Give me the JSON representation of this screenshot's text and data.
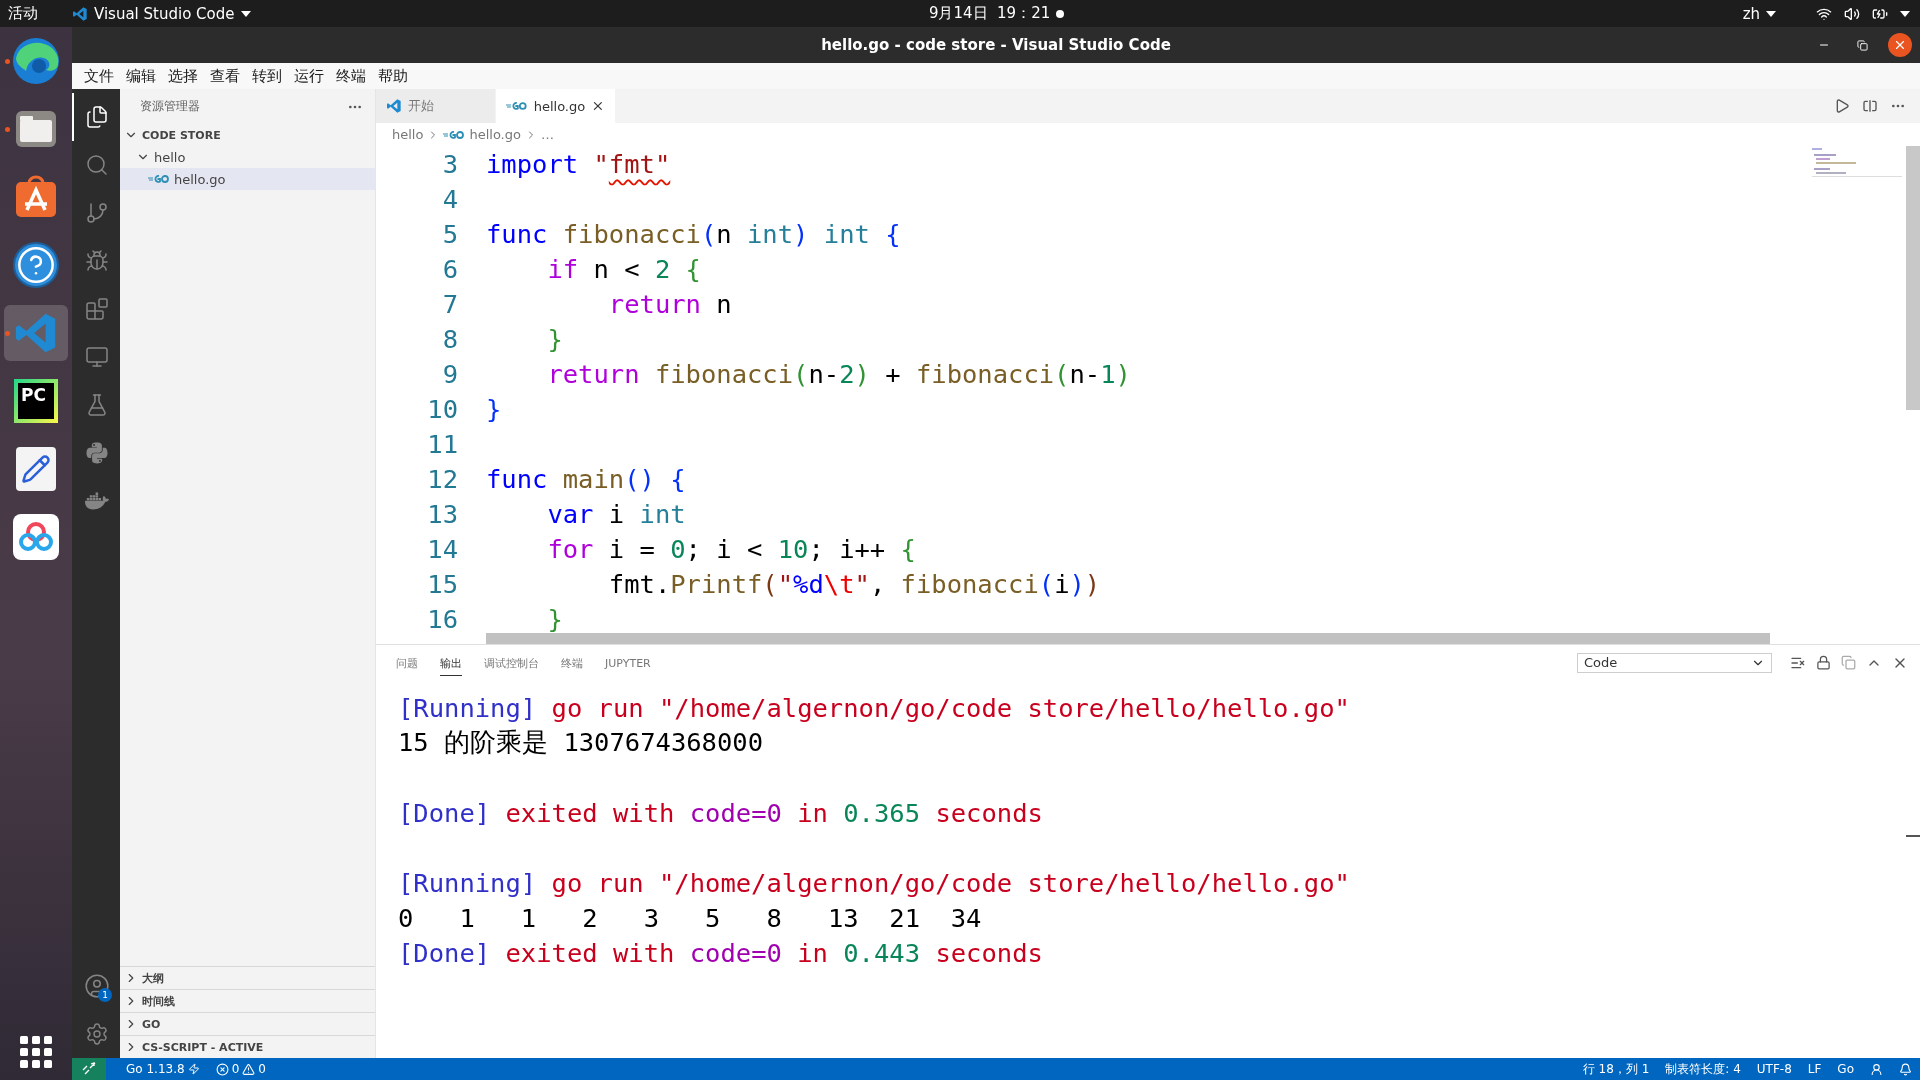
{
  "top_bar": {
    "activities": "活动",
    "app": "Visual Studio Code",
    "clock": "9月14日  19：21",
    "input_method": "zh"
  },
  "dock": [
    {
      "kind": "browser",
      "running": true,
      "selected": false
    },
    {
      "kind": "files",
      "running": true,
      "selected": false
    },
    {
      "kind": "store",
      "running": false,
      "selected": false
    },
    {
      "kind": "help",
      "running": false,
      "selected": false
    },
    {
      "kind": "vscode",
      "running": true,
      "selected": true
    },
    {
      "kind": "pycharm",
      "label": "PC",
      "running": false,
      "selected": false
    },
    {
      "kind": "editor",
      "running": false,
      "selected": false
    },
    {
      "kind": "cloud",
      "running": false,
      "selected": false
    }
  ],
  "window": {
    "title": "hello.go - code store - Visual Studio Code"
  },
  "menu": [
    "文件",
    "编辑",
    "选择",
    "查看",
    "转到",
    "运行",
    "终端",
    "帮助"
  ],
  "activity_bar": {
    "items": [
      {
        "kind": "explorer",
        "selected": true
      },
      {
        "kind": "search",
        "selected": false
      },
      {
        "kind": "source-control",
        "selected": false
      },
      {
        "kind": "run-debug",
        "selected": false
      },
      {
        "kind": "extensions",
        "selected": false
      },
      {
        "kind": "remote",
        "selected": false
      },
      {
        "kind": "testing",
        "selected": false
      },
      {
        "kind": "python",
        "selected": false
      },
      {
        "kind": "docker",
        "selected": false
      }
    ],
    "accounts_badge": "1"
  },
  "sidebar": {
    "title": "资源管理器",
    "workspace": {
      "label": "CODE STORE",
      "expanded": true,
      "children": [
        {
          "label": "hello",
          "expanded": true,
          "children": [
            {
              "label": "hello.go",
              "kind": "go-file",
              "selected": true
            }
          ]
        }
      ]
    },
    "sections": [
      {
        "label": "大纲",
        "expanded": false
      },
      {
        "label": "时间线",
        "expanded": false
      },
      {
        "label": "GO",
        "expanded": false
      },
      {
        "label": "CS-SCRIPT - ACTIVE",
        "expanded": false
      }
    ]
  },
  "editor": {
    "tabs": [
      {
        "label": "开始",
        "kind": "welcome",
        "selected": false
      },
      {
        "label": "hello.go",
        "kind": "go",
        "selected": true
      }
    ],
    "breadcrumbs": [
      {
        "label": "hello",
        "kind": "folder"
      },
      {
        "label": "hello.go",
        "kind": "go"
      },
      {
        "label": "…",
        "kind": "more"
      }
    ],
    "lines": [
      {
        "number": "3",
        "tokens": [
          {
            "kind": "kw",
            "text": "import "
          },
          {
            "kind": "str",
            "text": "\""
          },
          {
            "kind": "str",
            "text": "fmt\"",
            "error": true
          }
        ]
      },
      {
        "number": "4"
      },
      {
        "number": "5",
        "tokens": [
          {
            "kind": "kw",
            "text": "func "
          },
          {
            "kind": "fn",
            "text": "fibonacci"
          },
          {
            "kind": "b1",
            "text": "("
          },
          {
            "kind": "p",
            "text": "n "
          },
          {
            "kind": "type",
            "text": "int"
          },
          {
            "kind": "b1",
            "text": ") "
          },
          {
            "kind": "type",
            "text": "int "
          },
          {
            "kind": "b1",
            "text": "{"
          }
        ]
      },
      {
        "number": "6",
        "tokens": [
          {
            "kind": "ctrl",
            "text": "    if "
          },
          {
            "kind": "p",
            "text": "n < "
          },
          {
            "kind": "num",
            "text": "2 "
          },
          {
            "kind": "b2",
            "text": "{"
          }
        ]
      },
      {
        "number": "7",
        "tokens": [
          {
            "kind": "ctrl",
            "text": "        return "
          },
          {
            "kind": "p",
            "text": "n"
          }
        ]
      },
      {
        "number": "8",
        "tokens": [
          {
            "kind": "b2",
            "text": "    }"
          }
        ]
      },
      {
        "number": "9",
        "tokens": [
          {
            "kind": "ctrl",
            "text": "    return "
          },
          {
            "kind": "fn",
            "text": "fibonacci"
          },
          {
            "kind": "b2",
            "text": "("
          },
          {
            "kind": "p",
            "text": "n-"
          },
          {
            "kind": "num",
            "text": "2"
          },
          {
            "kind": "b2",
            "text": ") "
          },
          {
            "kind": "p",
            "text": "+ "
          },
          {
            "kind": "fn",
            "text": "fibonacci"
          },
          {
            "kind": "b2",
            "text": "("
          },
          {
            "kind": "p",
            "text": "n-"
          },
          {
            "kind": "num",
            "text": "1"
          },
          {
            "kind": "b2",
            "text": ")"
          }
        ]
      },
      {
        "number": "10",
        "tokens": [
          {
            "kind": "b1",
            "text": "}"
          }
        ]
      },
      {
        "number": "11"
      },
      {
        "number": "12",
        "tokens": [
          {
            "kind": "kw",
            "text": "func "
          },
          {
            "kind": "fn",
            "text": "main"
          },
          {
            "kind": "b1",
            "text": "() {"
          }
        ]
      },
      {
        "number": "13",
        "tokens": [
          {
            "kind": "kw",
            "text": "    var "
          },
          {
            "kind": "p",
            "text": "i "
          },
          {
            "kind": "type",
            "text": "int"
          }
        ]
      },
      {
        "number": "14",
        "tokens": [
          {
            "kind": "ctrl",
            "text": "    for "
          },
          {
            "kind": "p",
            "text": "i = "
          },
          {
            "kind": "num",
            "text": "0"
          },
          {
            "kind": "p",
            "text": "; i < "
          },
          {
            "kind": "num",
            "text": "10"
          },
          {
            "kind": "p",
            "text": "; i++ "
          },
          {
            "kind": "b2",
            "text": "{"
          }
        ]
      },
      {
        "number": "15",
        "tokens": [
          {
            "kind": "p",
            "text": "        fmt."
          },
          {
            "kind": "fn",
            "text": "Printf"
          },
          {
            "kind": "b3",
            "text": "("
          },
          {
            "kind": "str",
            "text": "\""
          },
          {
            "kind": "fmtv",
            "text": "%d"
          },
          {
            "kind": "esc",
            "text": "\\t"
          },
          {
            "kind": "str",
            "text": "\""
          },
          {
            "kind": "p",
            "text": ", "
          },
          {
            "kind": "fn",
            "text": "fibonacci"
          },
          {
            "kind": "b1",
            "text": "("
          },
          {
            "kind": "p",
            "text": "i"
          },
          {
            "kind": "b1",
            "text": ")"
          },
          {
            "kind": "b3",
            "text": ")"
          }
        ]
      },
      {
        "number": "16",
        "tokens": [
          {
            "kind": "b2",
            "text": "    }"
          }
        ]
      }
    ]
  },
  "panel": {
    "tabs": [
      {
        "label": "问题",
        "selected": false
      },
      {
        "label": "输出",
        "selected": true
      },
      {
        "label": "调试控制台",
        "selected": false
      },
      {
        "label": "终端",
        "selected": false
      },
      {
        "label": "JUPYTER",
        "selected": false
      }
    ],
    "channel": "Code",
    "output": [
      {
        "kind": "text",
        "segments": [
          {
            "kind": "tag",
            "text": "[Running]"
          },
          {
            "kind": "msg",
            "text": " go run \"/home/algernon/go/code store/hello/hello.go\""
          }
        ]
      },
      {
        "kind": "text",
        "segments": [
          {
            "kind": "p",
            "text": "15 的阶乘是 1307674368000"
          }
        ]
      },
      {
        "kind": "blank"
      },
      {
        "kind": "text",
        "segments": [
          {
            "kind": "tag",
            "text": "[Done]"
          },
          {
            "kind": "msg",
            "text": " exited with "
          },
          {
            "kind": "code",
            "text": "code=0"
          },
          {
            "kind": "msg",
            "text": " in "
          },
          {
            "kind": "num",
            "text": "0.365"
          },
          {
            "kind": "msg",
            "text": " seconds"
          }
        ]
      },
      {
        "kind": "blank"
      },
      {
        "kind": "text",
        "segments": [
          {
            "kind": "tag",
            "text": "[Running]"
          },
          {
            "kind": "msg",
            "text": " go run \"/home/algernon/go/code store/hello/hello.go\""
          }
        ]
      },
      {
        "kind": "text",
        "segments": [
          {
            "kind": "p",
            "text": "0\t1\t1\t2\t3\t5\t8\t13\t21\t34"
          }
        ]
      },
      {
        "kind": "text",
        "segments": [
          {
            "kind": "tag",
            "text": "[Done]"
          },
          {
            "kind": "msg",
            "text": " exited with "
          },
          {
            "kind": "code",
            "text": "code=0"
          },
          {
            "kind": "msg",
            "text": " in "
          },
          {
            "kind": "num",
            "text": "0.443"
          },
          {
            "kind": "msg",
            "text": " seconds"
          }
        ]
      }
    ]
  },
  "status_bar": {
    "go_version": "Go 1.13.8",
    "errors": "0",
    "warnings": "0",
    "items": [
      "行 18，列 1",
      "制表符长度: 4",
      "UTF-8",
      "LF",
      "Go"
    ]
  }
}
